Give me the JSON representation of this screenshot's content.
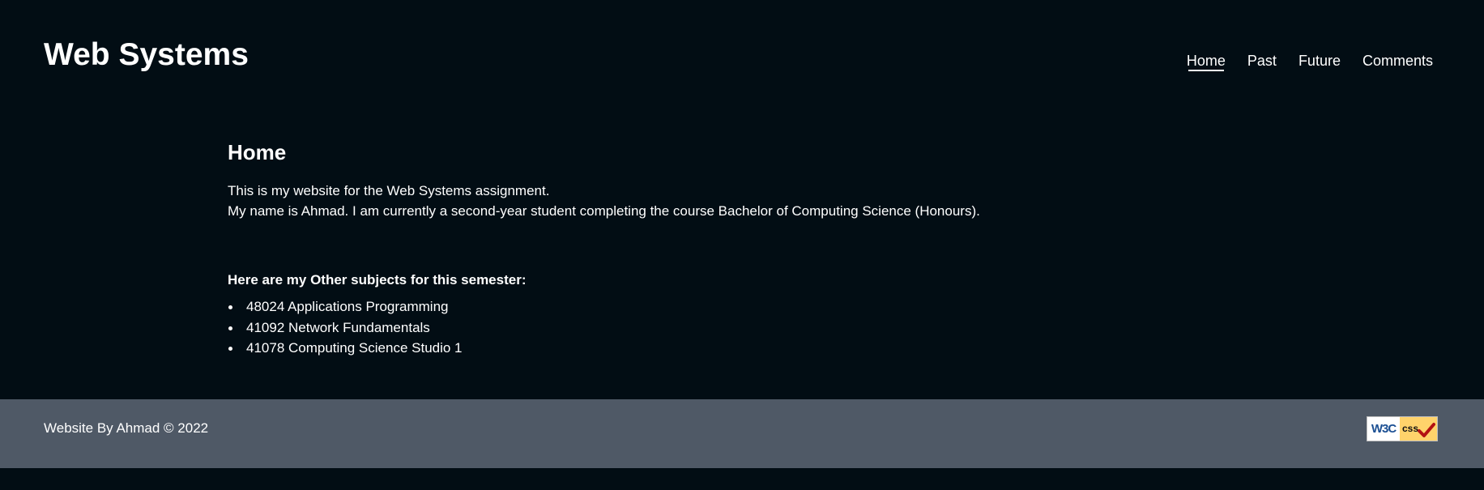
{
  "site": {
    "title": "Web Systems"
  },
  "nav": {
    "items": [
      {
        "label": "Home",
        "active": true
      },
      {
        "label": "Past",
        "active": false
      },
      {
        "label": "Future",
        "active": false
      },
      {
        "label": "Comments",
        "active": false
      }
    ]
  },
  "main": {
    "heading": "Home",
    "intro": [
      "This is my website for the Web Systems assignment.",
      "My name is Ahmad. I am currently a second-year student completing the course Bachelor of Computing Science (Honours)."
    ],
    "subjects_heading": "Here are my Other subjects for this semester:",
    "subjects": [
      "48024 Applications Programming",
      "41092 Network Fundamentals",
      "41078 Computing Science Studio 1"
    ]
  },
  "footer": {
    "text": "Website By Ahmad © 2022",
    "badge": {
      "w3c_text": "W3C",
      "css_text": "css",
      "icon": "check-mark-icon"
    }
  },
  "colors": {
    "background": "#020d14",
    "footer": "#4f5966",
    "badge_blue": "#1b4f93",
    "badge_yellow": "#ffd36b",
    "check_red": "#b31212"
  }
}
